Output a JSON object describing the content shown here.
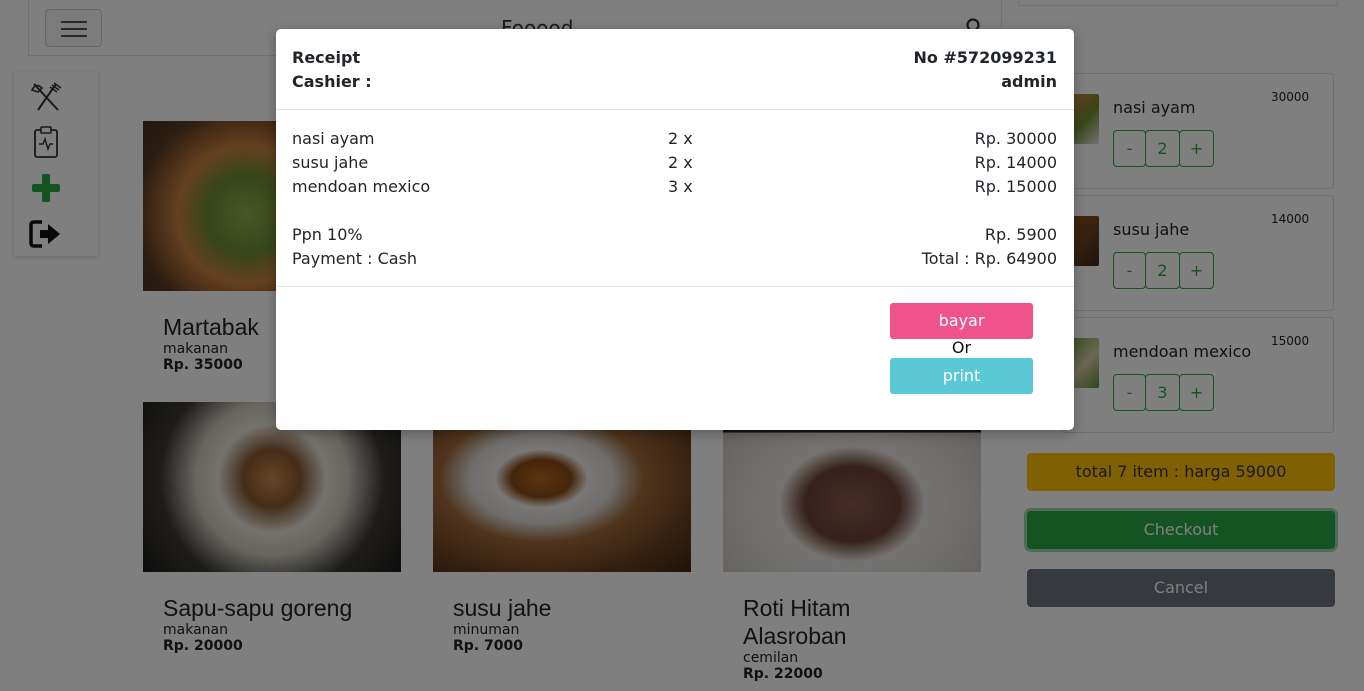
{
  "navbar": {
    "brand": "Fooood"
  },
  "cards": [
    {
      "name": "Martabak",
      "category": "makanan",
      "price": "Rp. 35000"
    },
    {
      "name": "Sapu-sapu goreng",
      "category": "makanan",
      "price": "Rp. 20000"
    },
    {
      "name": "susu jahe",
      "category": "minuman",
      "price": "Rp. 7000"
    },
    {
      "name": "Roti Hitam Alasroban",
      "category": "cemilan",
      "price": "Rp. 22000"
    }
  ],
  "cart": {
    "items": [
      {
        "name": "nasi ayam",
        "price": "30000",
        "qty": "2"
      },
      {
        "name": "susu jahe",
        "price": "14000",
        "qty": "2"
      },
      {
        "name": "mendoan mexico",
        "price": "15000",
        "qty": "3"
      }
    ],
    "minus_label": "-",
    "plus_label": "+",
    "total_label": "total 7 item : harga 59000",
    "checkout_label": "Checkout",
    "cancel_label": "Cancel"
  },
  "receipt": {
    "title": "Receipt",
    "number": "No #572099231",
    "cashier_label": "Cashier :",
    "cashier_name": "admin",
    "lines": [
      {
        "name": "nasi ayam",
        "qty": "2 x",
        "amount": "Rp. 30000"
      },
      {
        "name": "susu jahe",
        "qty": "2 x",
        "amount": "Rp. 14000"
      },
      {
        "name": "mendoan mexico",
        "qty": "3 x",
        "amount": "Rp. 15000"
      }
    ],
    "tax_label": "Ppn 10%",
    "tax_amount": "Rp. 5900",
    "payment_label": "Payment : Cash",
    "total_label": "Total : Rp. 64900",
    "pay_button": "bayar",
    "or_text": "Or",
    "print_button": "print"
  },
  "colors": {
    "checkout": "#28a745",
    "total_bar": "#ffc107",
    "cancel": "#6c757d",
    "pay": "#f0528a",
    "print": "#5bc8d6"
  }
}
